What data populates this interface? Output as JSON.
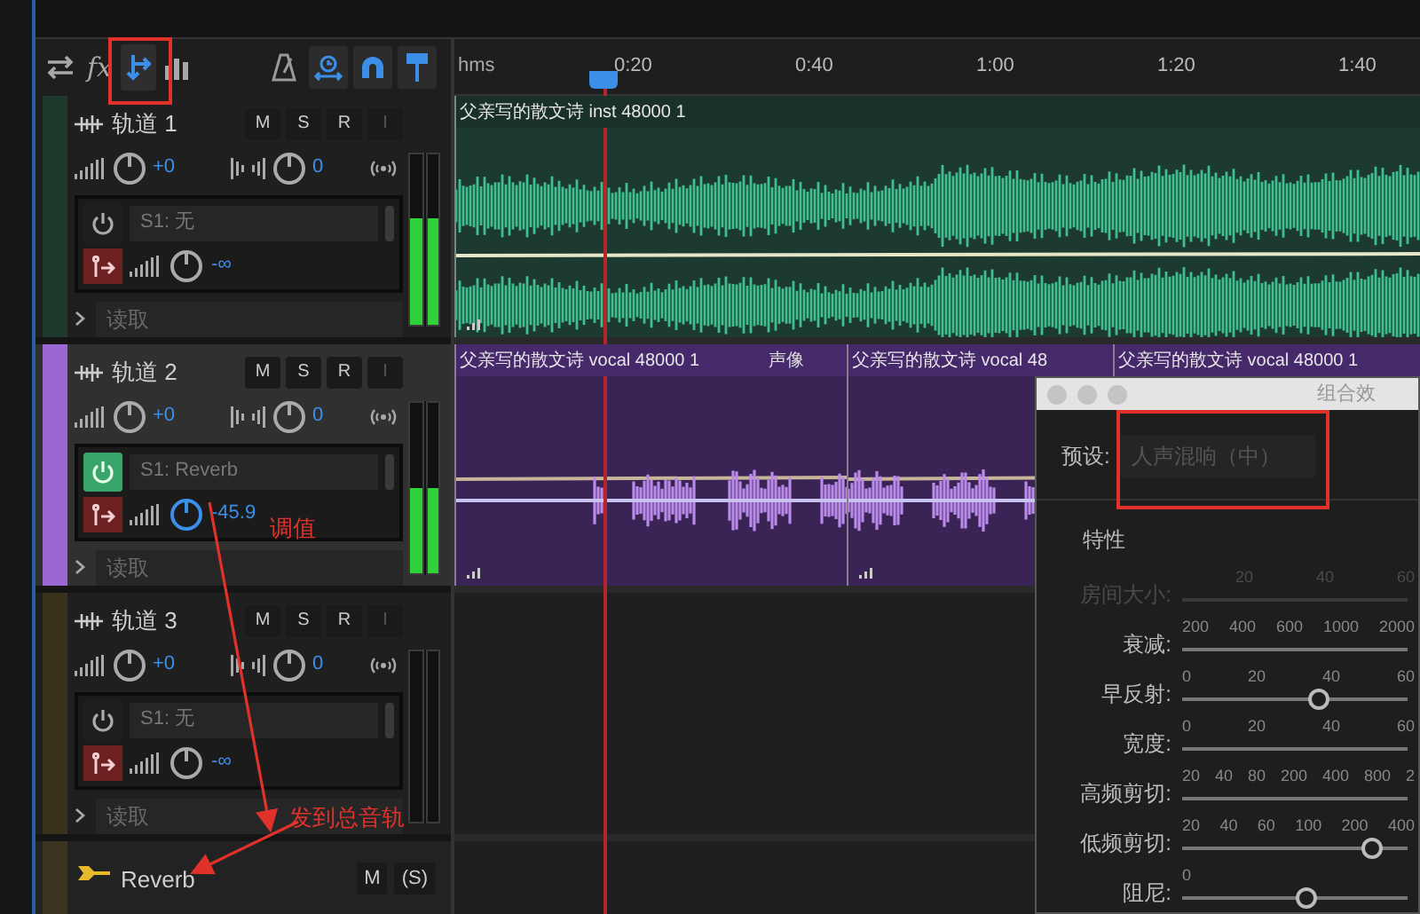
{
  "toolbar": {
    "left": [
      {
        "selected": false
      },
      {
        "label": "fx",
        "selected": false
      },
      {
        "selected": true
      },
      {
        "selected": false
      }
    ],
    "right": [
      {
        "on": false
      },
      {
        "on": true
      },
      {
        "on": true
      },
      {
        "on": true
      }
    ]
  },
  "tracks": [
    {
      "name": "轨道 1",
      "color": "#1d3a2c",
      "selected": false,
      "buttons": [
        "M",
        "S",
        "R",
        "I"
      ],
      "volume": "+0",
      "pan": "0",
      "send": {
        "on": false,
        "label": "S1: 无",
        "value": "-∞"
      },
      "automation": "读取",
      "meter": {
        "level": 0.62
      }
    },
    {
      "name": "轨道 2",
      "color": "#9a67d4",
      "selected": true,
      "buttons": [
        "M",
        "S",
        "R",
        "I"
      ],
      "volume": "+0",
      "pan": "0",
      "send": {
        "on": true,
        "label": "S1: Reverb",
        "value": "-45.9"
      },
      "automation": "读取",
      "meter": {
        "level": 0.5
      }
    },
    {
      "name": "轨道 3",
      "color": "#39331c",
      "selected": false,
      "buttons": [
        "M",
        "S",
        "R",
        "I"
      ],
      "volume": "+0",
      "pan": "0",
      "send": {
        "on": false,
        "label": "S1: 无",
        "value": "-∞"
      },
      "automation": "读取"
    }
  ],
  "bus": {
    "name": "Reverb",
    "color": "#3a3420",
    "buttons": [
      "M",
      "(S)"
    ]
  },
  "timeline": {
    "unit": "hms",
    "ticks": [
      "0:20",
      "0:40",
      "1:00",
      "1:20",
      "1:40"
    ],
    "lanes": [
      {
        "clips": [
          {
            "kind": "stereo",
            "title": "父亲写的散文诗 inst 48000 1"
          }
        ]
      },
      {
        "clips": [
          {
            "kind": "mono",
            "title": "父亲写的散文诗 vocal 48000 1",
            "effect": "声像"
          },
          {
            "kind": "mono",
            "title": "父亲写的散文诗 vocal 48"
          },
          {
            "kind": "mono",
            "title": "父亲写的散文诗 vocal 48000 1"
          }
        ]
      }
    ]
  },
  "effect_dialog": {
    "title": "组合效",
    "preset_label": "预设:",
    "preset": "人声混响（中）",
    "section": "特性",
    "params": [
      {
        "label": "房间大小:",
        "disabled": true,
        "scale": [
          "20",
          "40",
          "60"
        ]
      },
      {
        "label": "衰减:",
        "disabled": false,
        "scale": [
          "200",
          "400",
          "600",
          "1000",
          "2000"
        ]
      },
      {
        "label": "早反射:",
        "disabled": false,
        "scale": [
          "0",
          "20",
          "40",
          "60"
        ],
        "level": 0.61
      },
      {
        "label": "宽度:",
        "disabled": false,
        "scale": [
          "0",
          "20",
          "40",
          "60"
        ]
      },
      {
        "label": "高频剪切:",
        "disabled": false,
        "scale": [
          "20",
          "40",
          "80",
          "200",
          "400",
          "800",
          "2"
        ]
      },
      {
        "label": "低频剪切:",
        "disabled": false,
        "scale": [
          "20",
          "40",
          "60",
          "100",
          "200",
          "400"
        ],
        "level": 0.84
      },
      {
        "label": "阻尼:",
        "disabled": false,
        "scale": [
          "0"
        ],
        "level": 0.55
      }
    ]
  },
  "annotations": [
    {
      "text": "调值"
    },
    {
      "text": "发到总音轨"
    }
  ]
}
